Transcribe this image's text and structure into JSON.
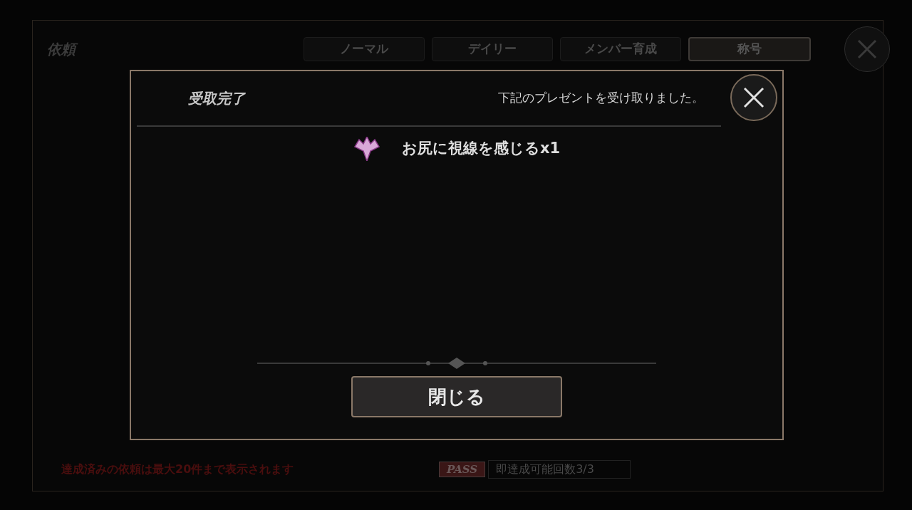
{
  "screen": {
    "title": "依頼",
    "tabs": [
      {
        "label": "ノーマル",
        "selected": false
      },
      {
        "label": "デイリー",
        "selected": false
      },
      {
        "label": "メンバー育成",
        "selected": false
      },
      {
        "label": "称号",
        "selected": true
      }
    ],
    "notice": "達成済みの依頼は最大20件まで表示されます",
    "pass_badge": "PASS",
    "instant_count": "即達成可能回数3/3"
  },
  "dialog": {
    "title": "受取完了",
    "message": "下記のプレゼントを受け取りました。",
    "rewards": [
      {
        "name": "お尻に視線を感じるx1"
      }
    ],
    "close_button": "閉じる"
  }
}
